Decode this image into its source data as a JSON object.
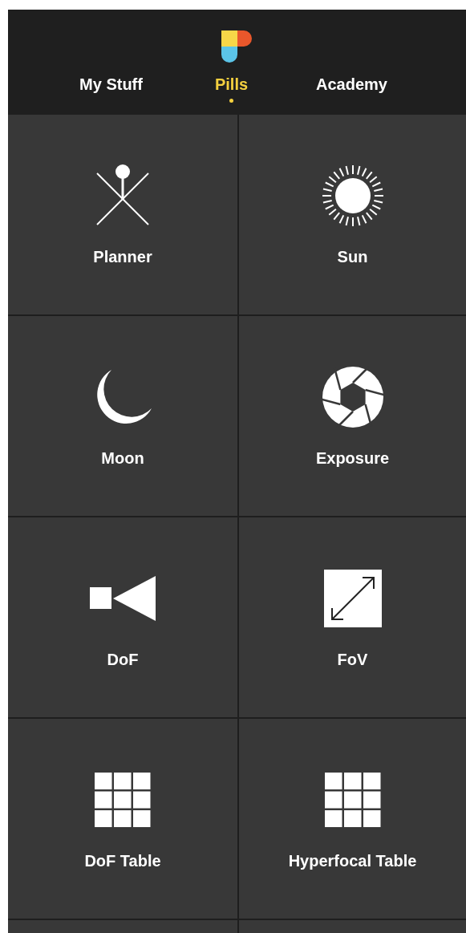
{
  "tabs": [
    {
      "label": "My Stuff",
      "selected": false
    },
    {
      "label": "Pills",
      "selected": true
    },
    {
      "label": "Academy",
      "selected": false
    }
  ],
  "tiles": [
    {
      "label": "Planner",
      "kind": "planner"
    },
    {
      "label": "Sun",
      "kind": "sun"
    },
    {
      "label": "Moon",
      "kind": "moon"
    },
    {
      "label": "Exposure",
      "kind": "exposure"
    },
    {
      "label": "DoF",
      "kind": "dof"
    },
    {
      "label": "FoV",
      "kind": "fov"
    },
    {
      "label": "DoF Table",
      "kind": "table"
    },
    {
      "label": "Hyperfocal Table",
      "kind": "table"
    }
  ]
}
